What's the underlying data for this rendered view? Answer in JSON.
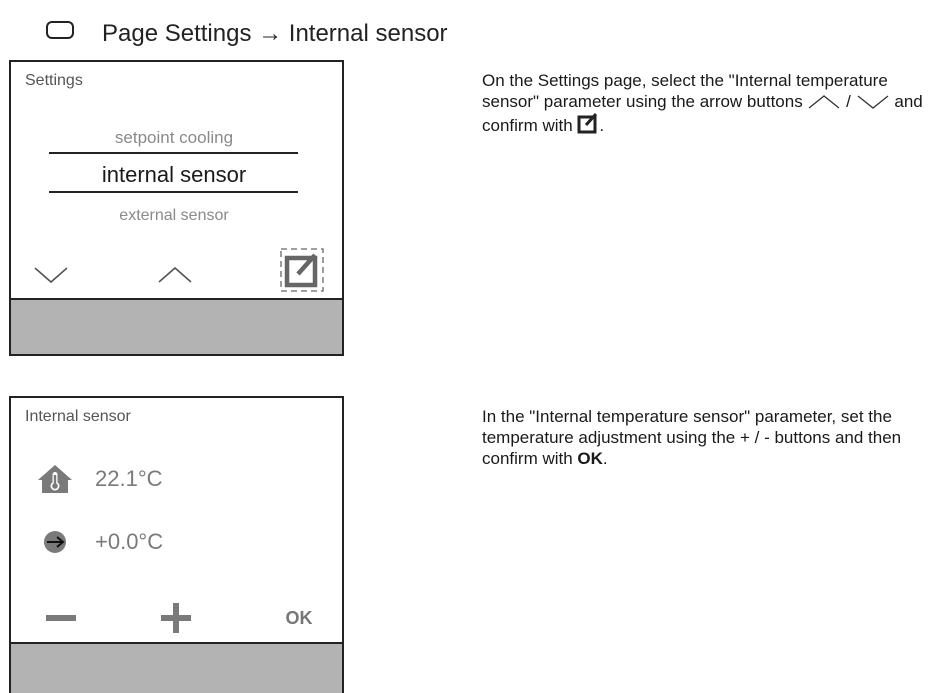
{
  "header": {
    "title": "Page Settings → Internal sensor",
    "icon": "rounded-rectangle-icon"
  },
  "settings_screen": {
    "title": "Settings",
    "menu_items": [
      "setpoint cooling",
      "internal sensor",
      "external sensor"
    ],
    "selected_index": 1,
    "buttons": [
      "chevron-down-icon",
      "chevron-up-icon",
      "edit-icon"
    ]
  },
  "settings_instructions": {
    "text_before_arrows": "On the Settings page, select the \"Internal temperature sensor\" parameter using the arrow buttons",
    "separator": "/",
    "text_after_arrows": "and confirm with",
    "end": "."
  },
  "sensor_screen": {
    "title": "Internal sensor",
    "temperature": "22.1°C",
    "adjustment": "+0.0°C",
    "buttons": [
      "minus-icon",
      "plus-icon"
    ],
    "ok_label": "OK"
  },
  "sensor_instructions": {
    "text": "In the \"Internal temperature sensor\" parameter, set the temperature adjustment using the + / - buttons and then confirm with",
    "ok": "OK",
    "end": "."
  },
  "colors": {
    "bottom_bar": "#b3b3b3",
    "icon_gray": "#7a7a7a",
    "border": "#222222"
  }
}
